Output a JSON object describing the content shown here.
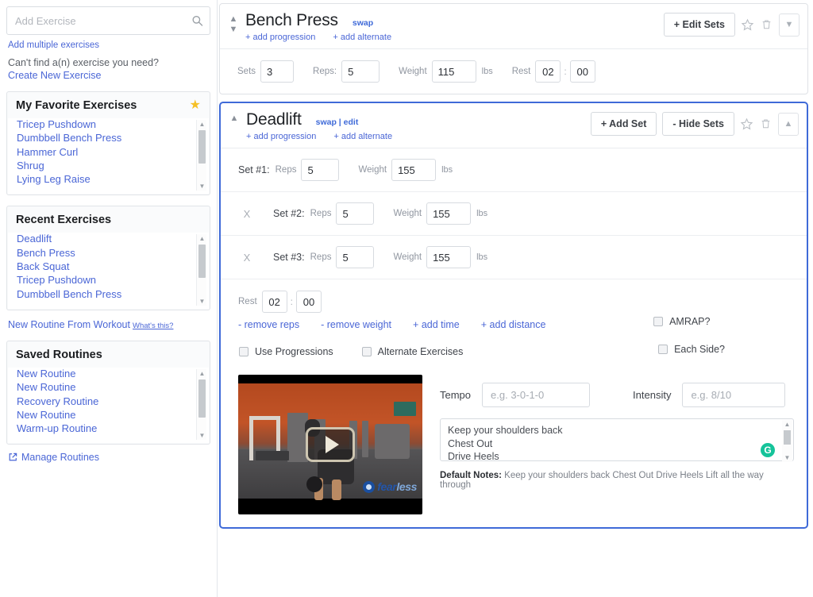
{
  "sidebar": {
    "search": {
      "placeholder": "Add Exercise",
      "value": "",
      "icon": "search-icon"
    },
    "add_multiple_label": "Add multiple exercises",
    "cant_find_text": "Can't find a(n) exercise you need?",
    "create_new_label": "Create New Exercise",
    "favorites": {
      "title": "My Favorite Exercises",
      "star_icon": "star-filled-icon",
      "items": [
        "Tricep Pushdown",
        "Dumbbell Bench Press",
        "Hammer Curl",
        "Shrug",
        "Lying Leg Raise"
      ]
    },
    "recent": {
      "title": "Recent Exercises",
      "items": [
        "Deadlift",
        "Bench Press",
        "Back Squat",
        "Tricep Pushdown",
        "Dumbbell Bench Press"
      ]
    },
    "new_routine_label": "New Routine From Workout",
    "whats_this_label": "What's this?",
    "saved_routines": {
      "title": "Saved Routines",
      "items": [
        "New Routine",
        "New Routine",
        "Recovery Routine",
        "New Routine",
        "Warm-up Routine"
      ]
    },
    "manage_routines_label": "Manage Routines",
    "manage_icon": "external-link-icon"
  },
  "colors": {
    "link_blue": "#4a66d6",
    "accent_blue": "#3f6ad8",
    "star_gold": "#f5c026",
    "grammarly_green": "#15c39a",
    "active_card_border": "#3f6ad8"
  },
  "exercises": [
    {
      "name": "Bench Press",
      "swap_label": "swap",
      "add_progression_label": "+ add progression",
      "add_alternate_label": "+ add alternate",
      "primary_button": "+ Edit Sets",
      "star_icon": "star-outline-icon",
      "delete_icon": "trash-icon",
      "collapse_icon": "chevron-down-icon",
      "move_up_icon": "chevron-up-icon",
      "move_down_icon": "chevron-down-icon",
      "simple": {
        "sets_label": "Sets",
        "sets_value": "3",
        "reps_label": "Reps:",
        "reps_value": "5",
        "weight_label": "Weight",
        "weight_value": "115",
        "unit": "lbs",
        "rest_label": "Rest",
        "rest_min": "02",
        "rest_sec": "00"
      }
    },
    {
      "name": "Deadlift",
      "swap_label": "swap",
      "separator": "|",
      "edit_label": "edit",
      "add_progression_label": "+ add progression",
      "add_alternate_label": "+ add alternate",
      "add_set_button": "+ Add Set",
      "hide_sets_button": "- Hide Sets",
      "star_icon": "star-outline-icon",
      "delete_icon": "trash-icon",
      "collapse_icon": "chevron-up-icon",
      "move_up_icon": "chevron-up-icon",
      "reps_label": "Reps",
      "weight_label": "Weight",
      "unit": "lbs",
      "remove_x": "X",
      "sets": [
        {
          "label": "Set #1:",
          "reps": "5",
          "weight": "155",
          "removable": false
        },
        {
          "label": "Set #2:",
          "reps": "5",
          "weight": "155",
          "removable": true
        },
        {
          "label": "Set #3:",
          "reps": "5",
          "weight": "155",
          "removable": true
        }
      ],
      "rest_label": "Rest",
      "rest_min": "02",
      "rest_sec": "00",
      "action_links": [
        "- remove reps",
        "- remove weight",
        "+ add time",
        "+ add distance"
      ],
      "amrap_label": "AMRAP?",
      "amrap_checked": false,
      "each_side_label": "Each Side?",
      "each_side_checked": false,
      "use_progressions_label": "Use Progressions",
      "use_progressions_checked": false,
      "alternate_exercises_label": "Alternate Exercises",
      "alternate_exercises_checked": false,
      "video": {
        "play_icon": "play-button-icon",
        "watermark_main": "fear",
        "watermark_sub": "less"
      },
      "tempo_label": "Tempo",
      "tempo_placeholder": "e.g. 3-0-1-0",
      "tempo_value": "",
      "intensity_label": "Intensity",
      "intensity_placeholder": "e.g. 8/10",
      "intensity_value": "",
      "notes_value": "Keep your shoulders back\nChest Out\nDrive Heels",
      "grammarly_icon": "grammarly-icon",
      "default_notes_label": "Default Notes:",
      "default_notes_text": "Keep your shoulders back Chest Out Drive Heels Lift all the way through"
    }
  ]
}
